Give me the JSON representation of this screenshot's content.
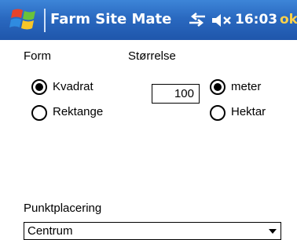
{
  "window": {
    "title": "Farm Site Mate",
    "clock": "16:03",
    "ok_label": "ok"
  },
  "form": {
    "shape_label": "Form",
    "size_label": "Størrelse",
    "shape_options": [
      {
        "label": "Kvadrat",
        "selected": true
      },
      {
        "label": "Rektange",
        "selected": false
      }
    ],
    "size_value": "100",
    "unit_options": [
      {
        "label": "meter",
        "selected": true
      },
      {
        "label": "Hektar",
        "selected": false
      }
    ],
    "placement_label": "Punktplacering",
    "placement_value": "Centrum"
  },
  "icons": {
    "start": "windows-flag-icon",
    "connectivity": "connectivity-arrows-icon",
    "volume": "volume-muted-icon"
  }
}
